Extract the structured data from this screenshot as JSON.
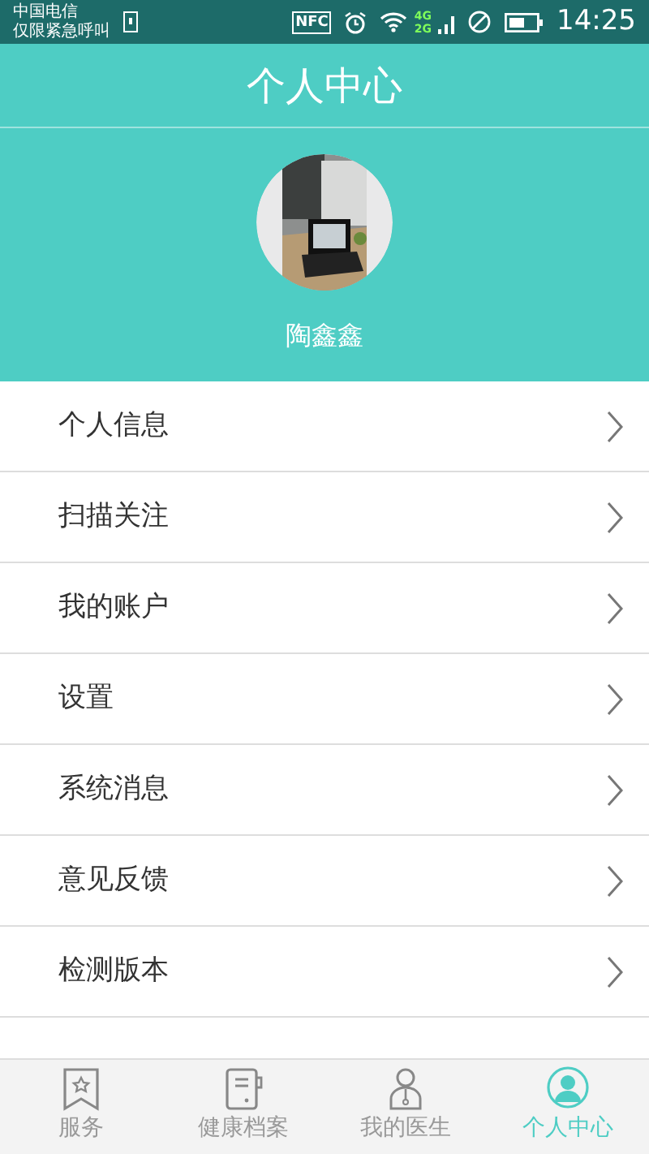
{
  "status_bar": {
    "carrier": "中国电信",
    "carrier_note": "仅限紧急呼叫",
    "nfc": "NFC",
    "net_top": "4G",
    "net_bottom": "2G",
    "time": "14:25"
  },
  "header": {
    "title": "个人中心"
  },
  "profile": {
    "name": "陶鑫鑫"
  },
  "menu": [
    {
      "label": "个人信息"
    },
    {
      "label": "扫描关注"
    },
    {
      "label": "我的账户"
    },
    {
      "label": "设置"
    },
    {
      "label": "系统消息"
    },
    {
      "label": "意见反馈"
    },
    {
      "label": "检测版本"
    }
  ],
  "tab_bar": [
    {
      "label": "服务",
      "selected": false
    },
    {
      "label": "健康档案",
      "selected": false
    },
    {
      "label": "我的医生",
      "selected": false
    },
    {
      "label": "个人中心",
      "selected": true
    }
  ]
}
